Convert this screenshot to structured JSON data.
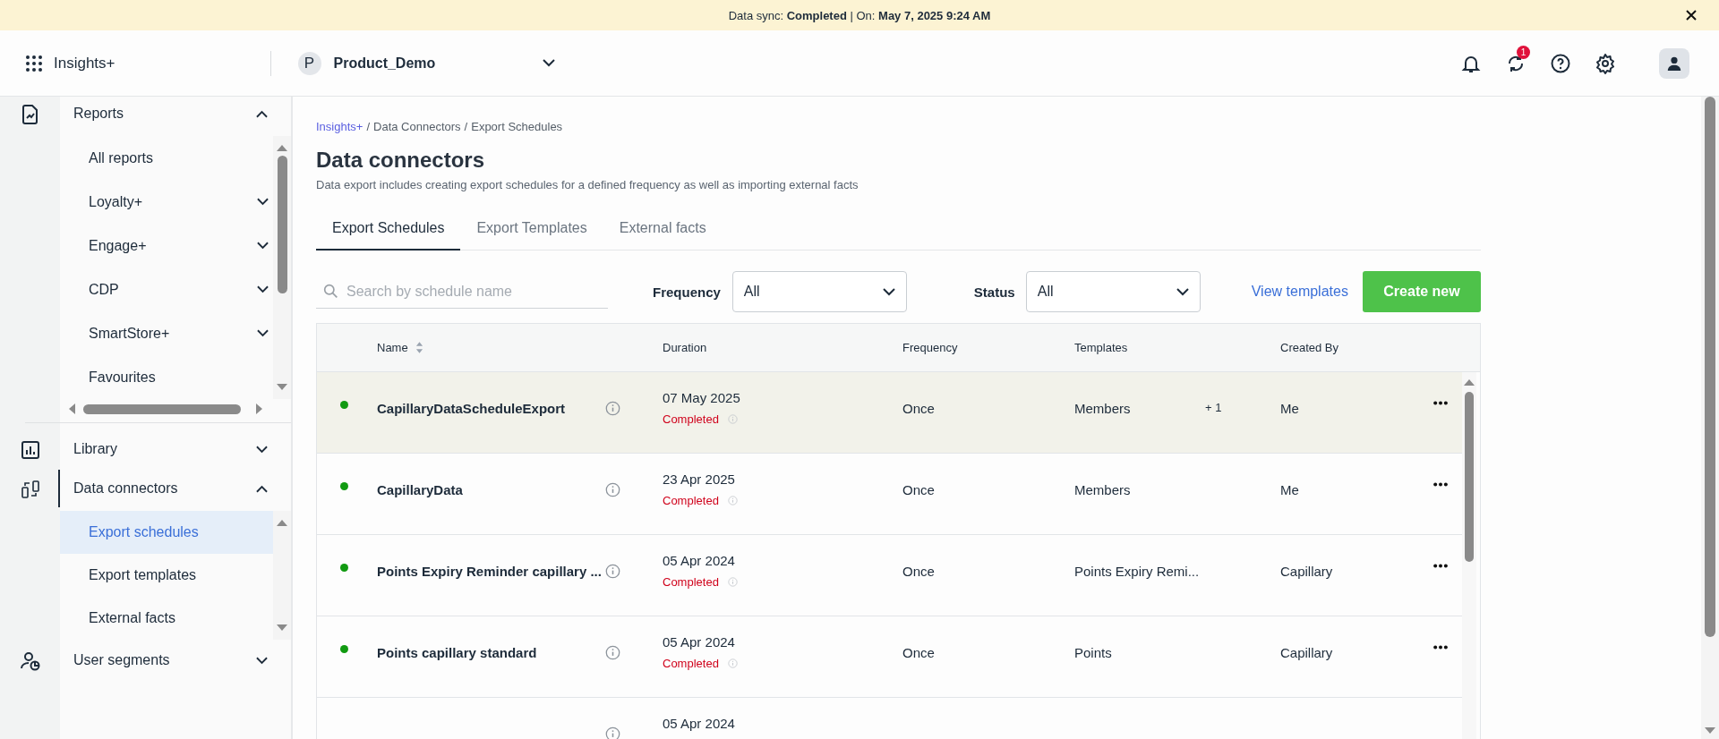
{
  "banner": {
    "label": "Data sync:",
    "status": "Completed",
    "separator": "|",
    "on_label": "On:",
    "date": "May 7, 2025 9:24 AM"
  },
  "header": {
    "app_name": "Insights+",
    "org_initial": "P",
    "org_name": "Product_Demo",
    "notification_count": "1"
  },
  "sidebar": {
    "sections": [
      {
        "label": "Reports",
        "expanded": true,
        "active": false,
        "children": [
          {
            "label": "All reports",
            "kind": "link",
            "selected": false
          },
          {
            "label": "Loyalty+",
            "kind": "group",
            "selected": false
          },
          {
            "label": "Engage+",
            "kind": "group",
            "selected": false
          },
          {
            "label": "CDP",
            "kind": "group",
            "selected": false
          },
          {
            "label": "SmartStore+",
            "kind": "group",
            "selected": false
          },
          {
            "label": "Favourites",
            "kind": "link",
            "selected": false
          }
        ]
      },
      {
        "label": "Library",
        "expanded": false,
        "active": false
      },
      {
        "label": "Data connectors",
        "expanded": true,
        "active": true,
        "children": [
          {
            "label": "Export schedules",
            "kind": "link",
            "selected": true
          },
          {
            "label": "Export templates",
            "kind": "link",
            "selected": false
          },
          {
            "label": "External facts",
            "kind": "link",
            "selected": false
          }
        ]
      },
      {
        "label": "User segments",
        "expanded": false,
        "active": false
      }
    ]
  },
  "main": {
    "breadcrumb": [
      {
        "label": "Insights+",
        "link": true
      },
      {
        "label": "/",
        "link": false
      },
      {
        "label": "Data Connectors",
        "link": false
      },
      {
        "label": "/",
        "link": false
      },
      {
        "label": "Export Schedules",
        "link": false
      }
    ],
    "title": "Data connectors",
    "description": "Data export includes creating export schedules for a defined frequency as well as importing external facts",
    "tabs": [
      {
        "label": "Export Schedules",
        "selected": true
      },
      {
        "label": "Export Templates",
        "selected": false
      },
      {
        "label": "External facts",
        "selected": false
      }
    ],
    "search": {
      "placeholder": "Search by schedule name"
    },
    "filters": [
      {
        "label": "Frequency",
        "value": "All"
      },
      {
        "label": "Status",
        "value": "All"
      }
    ],
    "view_templates": "View templates",
    "create_button": "Create new",
    "table": {
      "columns": [
        {
          "label": "Name",
          "sortable": true
        },
        {
          "label": "Duration",
          "sortable": false
        },
        {
          "label": "Frequency",
          "sortable": false
        },
        {
          "label": "Templates",
          "sortable": false
        },
        {
          "label": "Created By",
          "sortable": false
        }
      ],
      "rows": [
        {
          "color": "#119a11",
          "highlighted": true,
          "name": "CapillaryDataScheduleExport",
          "date": "07 May 2025",
          "status": "Completed",
          "frequency": "Once",
          "template": "Members",
          "extra": "+ 1",
          "created_by": "Me"
        },
        {
          "color": "#119a11",
          "highlighted": false,
          "name": "CapillaryData",
          "date": "23 Apr 2025",
          "status": "Completed",
          "frequency": "Once",
          "template": "Members",
          "created_by": "Me"
        },
        {
          "color": "#119a11",
          "highlighted": false,
          "name": "Points Expiry Reminder capillary ...",
          "date": "05 Apr 2024",
          "status": "Completed",
          "frequency": "Once",
          "template": "Points Expiry Remi...",
          "created_by": "Capillary"
        },
        {
          "color": "#119a11",
          "highlighted": false,
          "name": "Points capillary standard",
          "date": "05 Apr 2024",
          "status": "Completed",
          "frequency": "Once",
          "template": "Points",
          "created_by": "Capillary"
        },
        {
          "highlighted": false,
          "date": "05 Apr 2024"
        }
      ]
    }
  }
}
